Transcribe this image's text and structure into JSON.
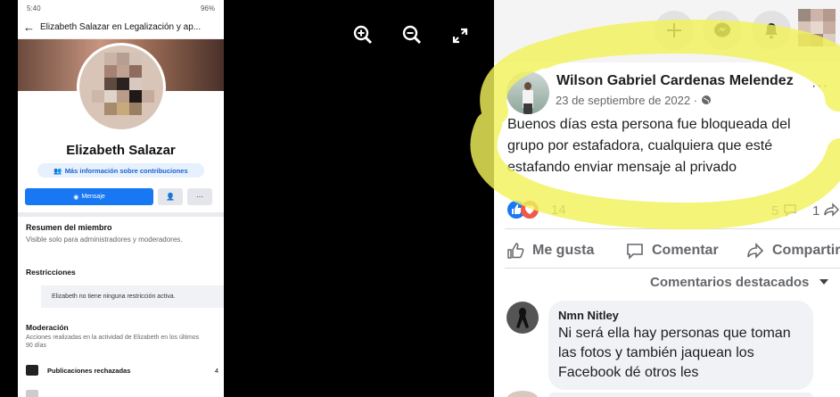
{
  "phone": {
    "status_time": "5:40",
    "status_battery": "96%",
    "header_title": "Elizabeth Salazar en Legalización y ap...",
    "profile_name": "Elizabeth Salazar",
    "contrib_label": "Más información sobre contribuciones",
    "message_button": "Mensaje",
    "more_button": "···",
    "summary_title": "Resumen del miembro",
    "summary_text": "Visible solo para administradores y moderadores.",
    "restrictions_title": "Restricciones",
    "restrictions_text": "Elizabeth no tiene ninguna restricción activa.",
    "moderation_title": "Moderación",
    "moderation_text": "Acciones realizadas en la actividad de Elizabeth en los últimos 90 días",
    "rejected_posts_label": "Publicaciones rechazadas",
    "rejected_posts_count": "4"
  },
  "post": {
    "author": "Wilson Gabriel Cardenas Melendez",
    "date": "23 de septiembre de 2022 · ",
    "more": "···",
    "text": "Buenos días esta persona fue bloqueada del grupo por estafadora, cualquiera que esté estafando enviar mensaje al privado",
    "reaction_count": "14",
    "comment_count": "5",
    "share_count": "1",
    "like_label": "Me gusta",
    "comment_label": "Comentar",
    "share_label": "Compartir",
    "featured_comments": "Comentarios destacados"
  },
  "comment": {
    "name": "Nmn Nitley",
    "text": "Ni será ella hay personas que toman las fotos y también jaquean los Facebook dé otros les"
  },
  "colors": {
    "facebook_blue": "#1877f2",
    "highlight_yellow": "#f2f25a"
  }
}
